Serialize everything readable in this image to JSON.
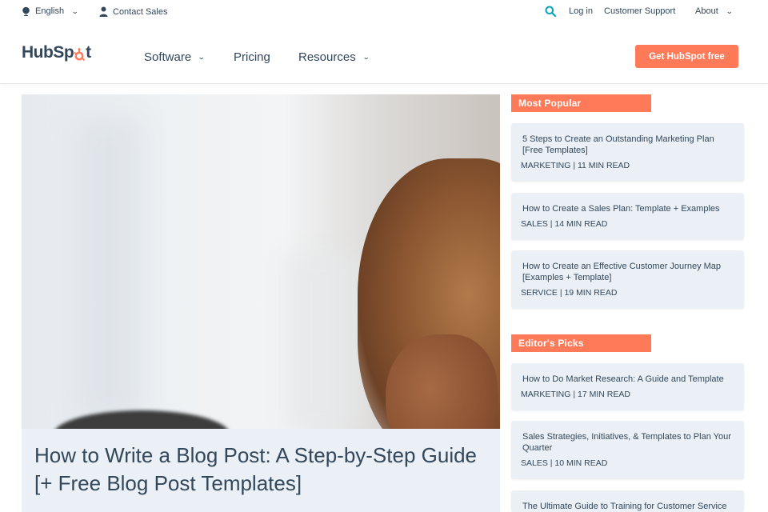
{
  "utility": {
    "language": "English",
    "contact": "Contact Sales",
    "login": "Log in",
    "support": "Customer Support",
    "about": "About"
  },
  "nav": {
    "logo_hub": "HubSp",
    "logo_ot": "t",
    "software": "Software",
    "pricing": "Pricing",
    "resources": "Resources",
    "cta": "Get HubSpot free"
  },
  "hero": {
    "title": "How to Write a Blog Post: A Step-by-Step Guide [+ Free Blog Post Templates]"
  },
  "most_popular": {
    "label": "Most Popular",
    "items": [
      {
        "title": "5 Steps to Create an Outstanding Marketing Plan [Free Templates]",
        "meta": "MARKETING | 11 MIN READ"
      },
      {
        "title": "How to Create a Sales Plan: Template + Examples",
        "meta": "SALES | 14 MIN READ"
      },
      {
        "title": "How to Create an Effective Customer Journey Map [Examples + Template]",
        "meta": "SERVICE | 19 MIN READ"
      }
    ]
  },
  "editors_picks": {
    "label": "Editor's Picks",
    "items": [
      {
        "title": "How to Do Market Research: A Guide and Template",
        "meta": "MARKETING | 17 MIN READ"
      },
      {
        "title": "Sales Strategies, Initiatives, & Templates to Plan Your Quarter",
        "meta": "SALES | 10 MIN READ"
      },
      {
        "title": "The Ultimate Guide to Training for Customer Service",
        "meta": ""
      }
    ]
  },
  "colors": {
    "accent": "#ff7a59",
    "text": "#33475b",
    "card_bg": "#eaf0f6",
    "search_icon": "#00a4bd"
  },
  "icons": [
    "globe-icon",
    "person-icon",
    "search-icon",
    "chevron-down-icon",
    "sprocket-icon"
  ]
}
